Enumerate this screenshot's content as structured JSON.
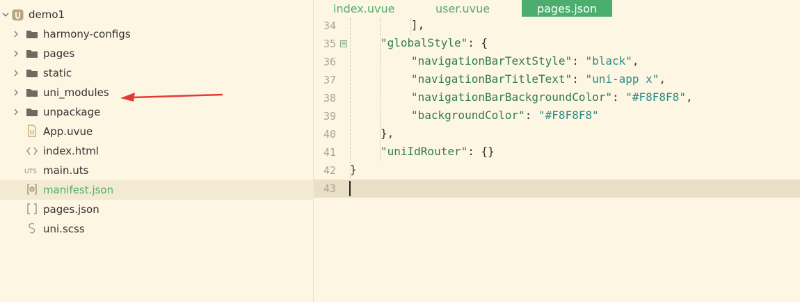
{
  "sidebar": {
    "root": {
      "label": "demo1"
    },
    "items": [
      {
        "label": "harmony-configs",
        "type": "folder",
        "icon": "folder-icon"
      },
      {
        "label": "pages",
        "type": "folder",
        "icon": "folder-icon"
      },
      {
        "label": "static",
        "type": "folder",
        "icon": "folder-icon"
      },
      {
        "label": "uni_modules",
        "type": "folder",
        "icon": "folder-icon"
      },
      {
        "label": "unpackage",
        "type": "folder",
        "icon": "folder-icon"
      },
      {
        "label": "App.uvue",
        "type": "file",
        "icon": "vue-file-icon"
      },
      {
        "label": "index.html",
        "type": "file",
        "icon": "html-file-icon"
      },
      {
        "label": "main.uts",
        "type": "file",
        "icon": "uts-file-icon",
        "badge": "UTS"
      },
      {
        "label": "manifest.json",
        "type": "file",
        "icon": "manifest-icon",
        "selected": true
      },
      {
        "label": "pages.json",
        "type": "file",
        "icon": "json-file-icon",
        "badge": "[ ]"
      },
      {
        "label": "uni.scss",
        "type": "file",
        "icon": "scss-file-icon"
      }
    ]
  },
  "tabs": [
    {
      "label": "index.uvue",
      "active": false
    },
    {
      "label": "user.uvue",
      "active": false
    },
    {
      "label": "pages.json",
      "active": true
    }
  ],
  "editor": {
    "lines": [
      {
        "num": "34",
        "text": "],",
        "indent": 3
      },
      {
        "num": "35",
        "text": "\"globalStyle\": {",
        "indent": 2,
        "fold": "⊟"
      },
      {
        "num": "36",
        "text": "\"navigationBarTextStyle\": \"black\",",
        "indent": 3
      },
      {
        "num": "37",
        "text": "\"navigationBarTitleText\": \"uni-app x\",",
        "indent": 3
      },
      {
        "num": "38",
        "text": "\"navigationBarBackgroundColor\": \"#F8F8F8\",",
        "indent": 3
      },
      {
        "num": "39",
        "text": "\"backgroundColor\": \"#F8F8F8\"",
        "indent": 3
      },
      {
        "num": "40",
        "text": "},",
        "indent": 2
      },
      {
        "num": "41",
        "text": "\"uniIdRouter\": {}",
        "indent": 2
      },
      {
        "num": "42",
        "text": "}",
        "indent": 1
      },
      {
        "num": "43",
        "text": "",
        "indent": 1,
        "current": true
      }
    ]
  },
  "colors": {
    "accent": "#4CAE6E",
    "background": "#FDF6E3",
    "key": "#2E7D47",
    "string": "#2A8A87",
    "arrow": "#E53935"
  }
}
